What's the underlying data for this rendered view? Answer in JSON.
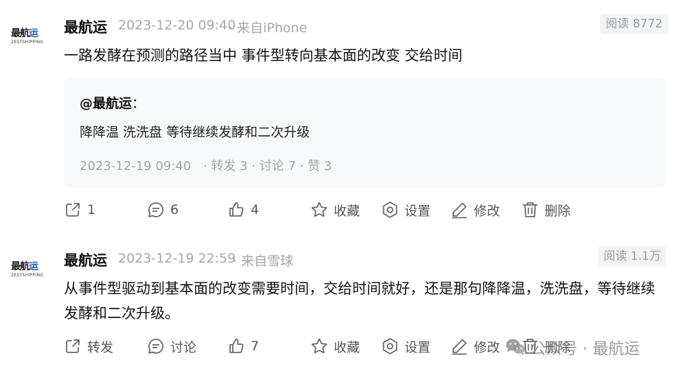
{
  "posts": [
    {
      "logo": {
        "main_black": "最航",
        "main_blue": "运",
        "sub": "ZESTSHIPPING"
      },
      "author": "最航运",
      "time": "2023-12-20 09:40",
      "source": "· 来自iPhone",
      "reads": "阅读 8772",
      "content": "一路发酵在预测的路径当中 事件型转向基本面的改变 交给时间",
      "quote": {
        "author": "@最航运",
        "colon": "：",
        "text": "降降温 洗洗盘 等待继续发酵和二次升级",
        "time": "2023-12-19 09:40",
        "stats": "· 转发 3 · 讨论 7 · 赞 3"
      },
      "actions": {
        "share": "1",
        "comment": "6",
        "like": "4",
        "favorite": "收藏",
        "settings": "设置",
        "edit": "修改",
        "delete": "删除"
      }
    },
    {
      "logo": {
        "main_black": "最航",
        "main_blue": "运",
        "sub": "ZESTSHIPPING"
      },
      "author": "最航运",
      "time": "2023-12-19 22:59",
      "source": "· 来自雪球",
      "reads": "阅读 1.1万",
      "content": "从事件型驱动到基本面的改变需要时间，交给时间就好，还是那句降降温，洗洗盘，等待继续发酵和二次升级。",
      "actions": {
        "share": "转发",
        "comment": "讨论",
        "like": "7",
        "favorite": "收藏",
        "settings": "设置",
        "edit": "修改",
        "delete": "删除"
      }
    }
  ],
  "watermark": {
    "text": "公众号 · 最航运",
    "icon": "wechat-icon"
  },
  "colors": {
    "brand_blue": "#1e5bb8",
    "meta_gray": "#a6a6a6",
    "icon_gray": "#666666",
    "quote_bg": "#f7f8fa"
  }
}
